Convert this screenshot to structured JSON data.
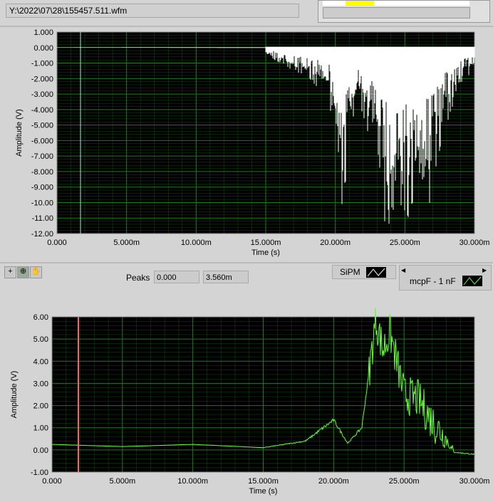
{
  "file_path": "Y:\\2022\\07\\28\\155457.511.wfm",
  "graph1": {
    "ylabel": "Amplitude (V)",
    "xlabel": "Time (s)",
    "yticks": [
      "1.000",
      "0.000",
      "-1.000",
      "-2.000",
      "-3.000",
      "-4.000",
      "-5.000",
      "-6.000",
      "-7.000",
      "-8.000",
      "-9.000",
      "-10.00",
      "-11.00",
      "-12.00"
    ],
    "xticks": [
      "0.000",
      "5.000m",
      "10.000m",
      "15.000m",
      "20.000m",
      "25.000m",
      "30.000m"
    ]
  },
  "graph2": {
    "ylabel": "Amplitude (V)",
    "xlabel": "Time (s)",
    "yticks": [
      "6.00",
      "5.00",
      "4.00",
      "3.00",
      "2.00",
      "1.00",
      "0.00",
      "-1.00"
    ],
    "xticks": [
      "0.000",
      "5.000m",
      "10.000m",
      "15.000m",
      "20.000m",
      "25.000m",
      "30.000m"
    ]
  },
  "toolbar": {
    "peaks_label": "Peaks",
    "peak_value1": "0.000",
    "peak_value2": "3.560m",
    "legend1": "SiPM",
    "legend2": "mcpF - 1 nF"
  },
  "colors": {
    "plot_bg": "#000000",
    "grid": "#1f7a1f",
    "trace1": "#ffffff",
    "trace2": "#66ff33",
    "cursor": "#ff2020"
  },
  "chart_data": [
    {
      "type": "line",
      "title": "",
      "xlabel": "Time (s)",
      "ylabel": "Amplitude (V)",
      "xlim": [
        0,
        0.03
      ],
      "ylim": [
        -12,
        1
      ],
      "series": [
        {
          "name": "SiPM",
          "envelope_min_x_ms": [
            0,
            15,
            17,
            19.5,
            20.5,
            21.5,
            22.5,
            23.5,
            25,
            26.5,
            28,
            30
          ],
          "envelope_min_y": [
            0,
            -0.5,
            -1.5,
            -3,
            -11,
            -3,
            -6,
            -11.5,
            -11,
            -11.2,
            -5,
            -1
          ]
        }
      ]
    },
    {
      "type": "line",
      "title": "",
      "xlabel": "Time (s)",
      "ylabel": "Amplitude (V)",
      "xlim": [
        0,
        0.03
      ],
      "ylim": [
        -1,
        6
      ],
      "series": [
        {
          "name": "mcpF - 1 nF",
          "x_ms": [
            0,
            5,
            10,
            15,
            18,
            20,
            21,
            22,
            23,
            23.5,
            24,
            25,
            26,
            27,
            28,
            28.5,
            30
          ],
          "y": [
            0.25,
            0.15,
            0.25,
            0.1,
            0.4,
            1.35,
            0.3,
            1.0,
            5.9,
            4.5,
            5.3,
            2.5,
            2.3,
            1.3,
            0.5,
            -0.1,
            -0.2
          ]
        }
      ]
    }
  ]
}
